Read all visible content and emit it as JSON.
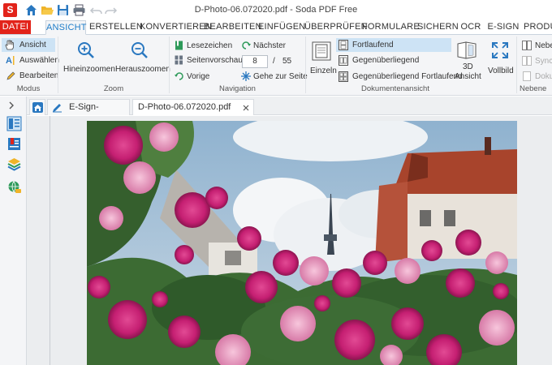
{
  "titlebar": {
    "app_logo": "S",
    "title": "D-Photo-06.072020.pdf - Soda PDF Free"
  },
  "menu": {
    "tabs": [
      "DATEI",
      "ANSICHT",
      "ERSTELLEN",
      "KONVERTIEREN",
      "BEARBEITEN",
      "EINFÜGEN",
      "ÜBERPRÜFEN",
      "FORMULARE",
      "SICHERN",
      "OCR",
      "E-SIGN",
      "PRODU"
    ]
  },
  "ribbon": {
    "modus": {
      "label": "Modus",
      "ansicht": "Ansicht",
      "auswaehlen": "Auswählen",
      "bearbeiten": "Bearbeiten"
    },
    "zoom": {
      "label": "Zoom",
      "hinein": "Hineinzoomen",
      "heraus": "Herauszoomen"
    },
    "navigation": {
      "label": "Navigation",
      "lesezeichen": "Lesezeichen",
      "seitenvorschau": "Seitenvorschau",
      "vorige": "Vorige",
      "naechster": "Nächster",
      "page_value": "8",
      "page_separator": "/",
      "page_total": "55",
      "gehe_zu": "Gehe zur Seite"
    },
    "dokumentenansicht": {
      "label": "Dokumentenansicht",
      "einzeln": "Einzeln",
      "fortlaufend": "Fortlaufend",
      "gegenueber": "Gegenüberliegend",
      "gegenueber_fort": "Gegenüberliegend Fortlaufend",
      "ansicht_3d_line1": "3D",
      "ansicht_3d_line2": "Ansicht",
      "vollbild": "Vollbild"
    },
    "nebeneinander": {
      "label": "Nebene",
      "item1": "Nebe",
      "item2": "Synch",
      "item3": "Doku"
    }
  },
  "doctabs": {
    "esign_manager": "E-Sign-Manager",
    "document": "D-Photo-06.072020.pdf"
  },
  "colors": {
    "accent": "#1e7cc8",
    "brand_red": "#e2231a",
    "ribbon_bg": "#f4f5f7",
    "selected": "#cde3f5"
  }
}
